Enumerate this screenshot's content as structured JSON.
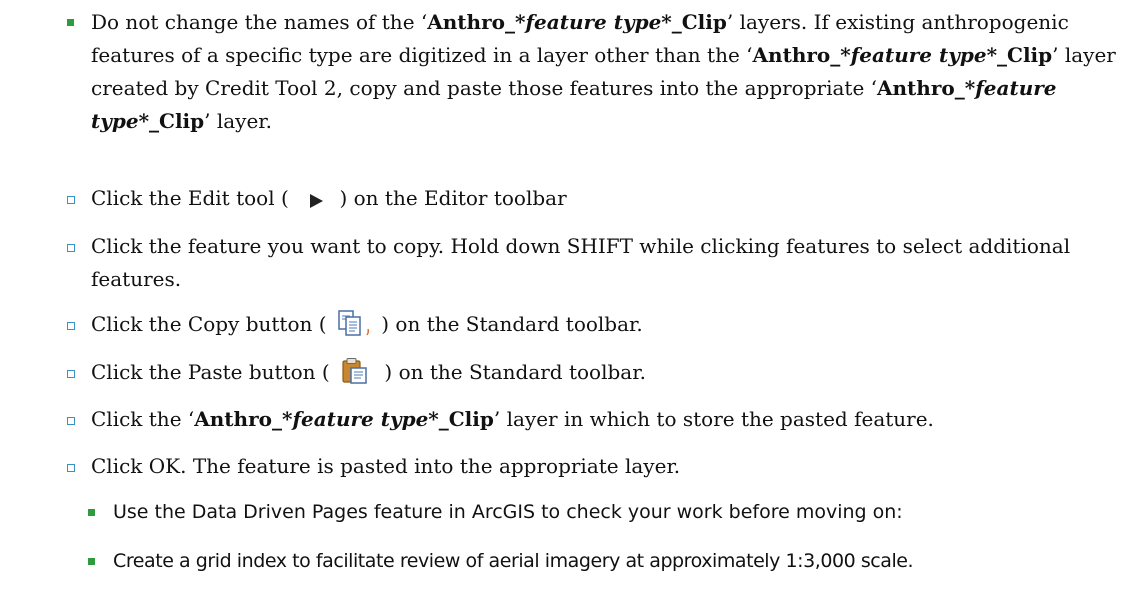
{
  "para1": {
    "s1": "Do not change the names of the ‘",
    "layer_a": "Anthro_*",
    "layer_b": "feature type",
    "layer_c": "*_Clip",
    "s2": "’ layers. If existing anthropogenic features of a specific type are digitized in a layer other than the ‘",
    "s3": "’ layer created by Credit Tool 2, copy and paste those features into the appropriate ‘",
    "s4": "’ layer."
  },
  "steps": {
    "edit_pre": "Click the Edit tool (",
    "edit_post": ") on the Editor toolbar",
    "select": "Click the feature you want to copy. Hold down SHIFT while clicking features to select additional features.",
    "copy_pre": "Click the Copy button (",
    "copy_post": ") on the Standard toolbar.",
    "paste_pre": "Click the Paste button (",
    "paste_post": ") on the Standard toolbar.",
    "layer_pre": "Click the ‘",
    "layer_post": "’ layer in which to store the pasted feature.",
    "ok": "Click OK. The feature is pasted into the appropriate layer."
  },
  "data_driven": "Use the Data Driven Pages feature in ArcGIS to check your work before moving on:",
  "grid_index": "Create a grid index to facilitate review of aerial imagery at approximately 1:3,000 scale.",
  "icons": [
    "edit-tool-arrow-icon",
    "copy-icon",
    "paste-icon"
  ],
  "colors": {
    "square_bullet": "#2e9c3c",
    "hollow_bullet": "#3b8fc7"
  }
}
